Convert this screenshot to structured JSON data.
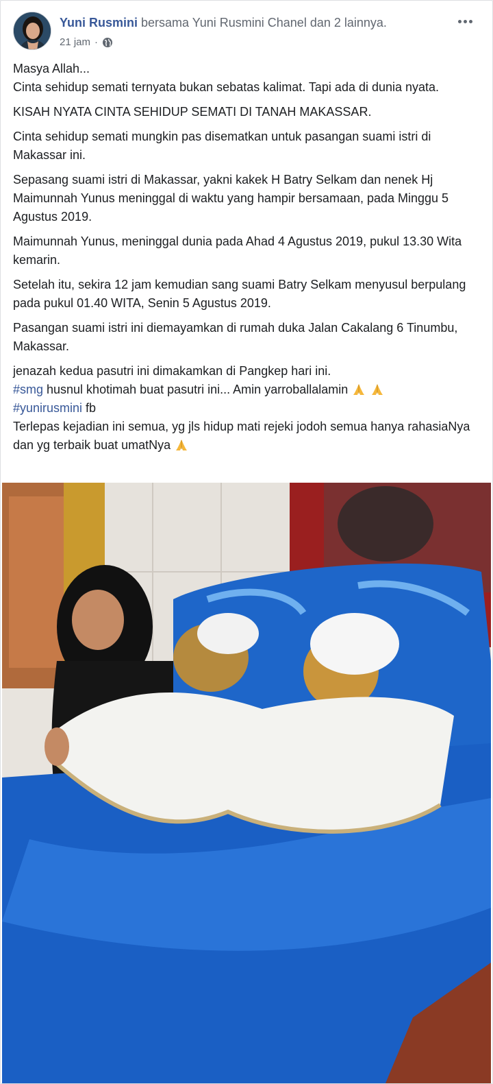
{
  "post": {
    "author": "Yuni Rusmini",
    "with_text": " bersama Yuni Rusmini Chanel dan 2 lainnya.",
    "time": "21 jam",
    "separator": "·",
    "privacy_icon": "globe-icon",
    "more_icon": "more-options-icon",
    "paragraphs": [
      [
        "Masya Allah...",
        "Cinta sehidup semati ternyata bukan sebatas kalimat. Tapi ada di dunia nyata."
      ],
      [
        "KISAH NYATA CINTA SEHIDUP SEMATI DI TANAH MAKASSAR."
      ],
      [
        "Cinta sehidup semati mungkin pas disematkan untuk pasangan suami istri di Makassar ini."
      ],
      [
        "Sepasang suami istri di Makassar, yakni kakek H Batry Selkam dan nenek Hj Maimunnah Yunus meninggal di waktu yang hampir bersamaan, pada Minggu 5 Agustus 2019."
      ],
      [
        "Maimunnah Yunus, meninggal dunia pada Ahad 4 Agustus 2019, pukul 13.30 Wita kemarin."
      ],
      [
        "Setelah itu, sekira 12 jam kemudian sang suami Batry Selkam menyusul berpulang pada pukul 01.40 WITA, Senin 5 Agustus 2019."
      ],
      [
        "Pasangan suami istri ini diemayamkan di rumah duka Jalan Cakalang 6 Tinumbu, Makassar."
      ]
    ],
    "last": {
      "line1": "jenazah kedua pasutri ini dimakamkan di Pangkep hari ini.",
      "hashtag1": "#smg",
      "line2": " husnul khotimah buat pasutri ini... Amin yarroballalamin",
      "hashtag2": "#yunirusmini",
      "line3": " fb",
      "line4": "Terlepas kejadian ini semua, yg jls hidup mati rejeki jodoh semua hanya rahasiaNya dan yg terbaik buat umatNya"
    },
    "emoji_icon": "folded-hands-icon"
  },
  "colors": {
    "link": "#385898",
    "text": "#1c1e21",
    "meta": "#606770",
    "sheet_blue": "#1a5fc4"
  }
}
